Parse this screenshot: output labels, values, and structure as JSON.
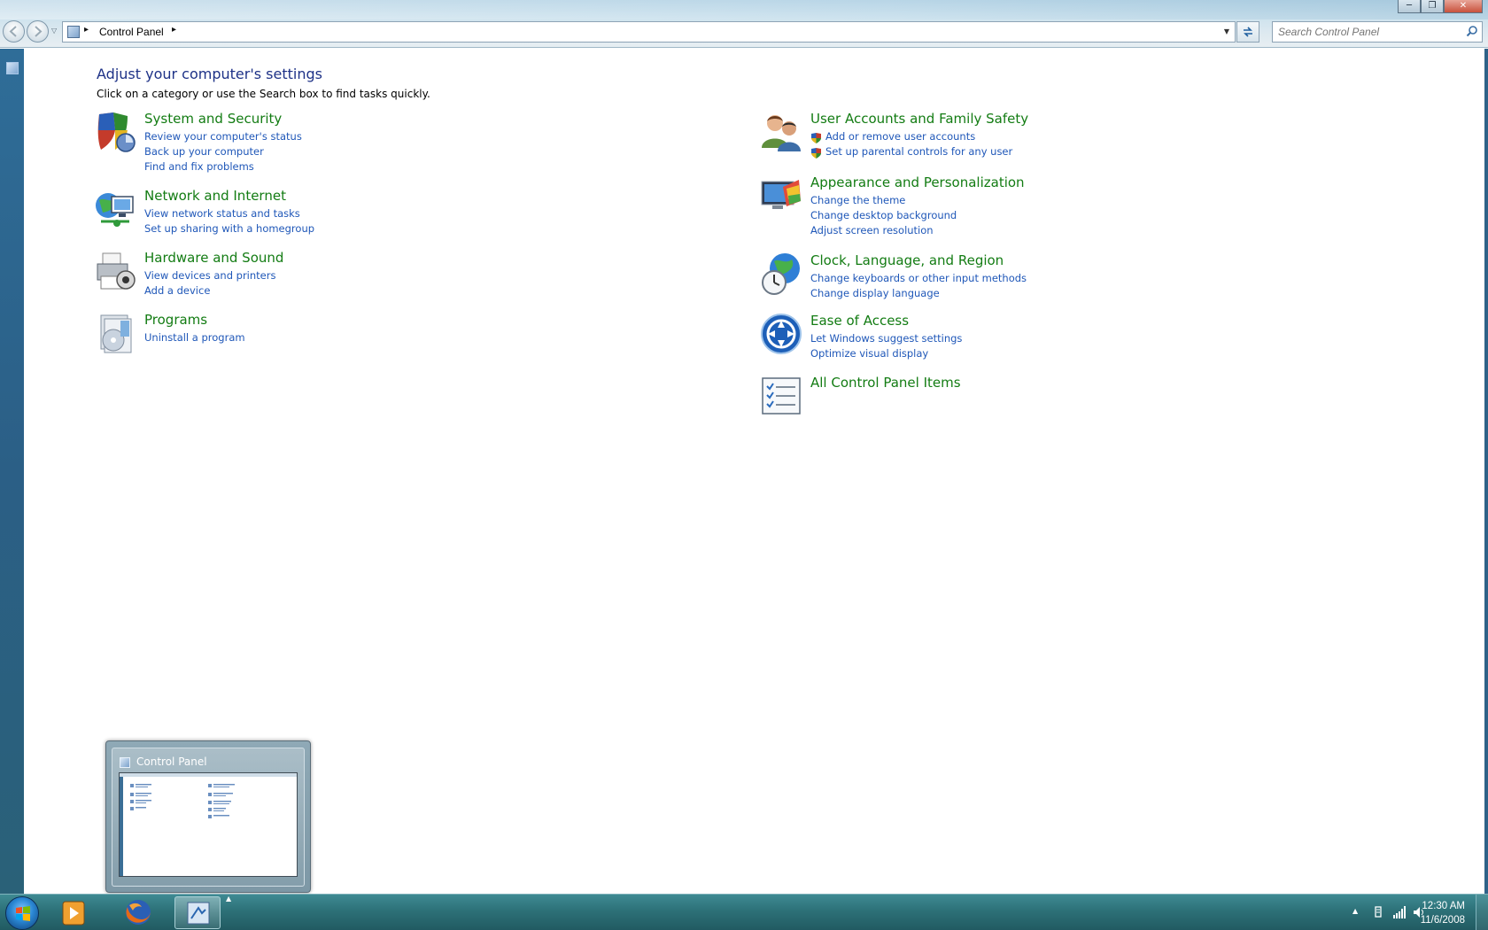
{
  "window": {
    "minimize_label": "─",
    "maximize_label": "❐",
    "close_label": "✕"
  },
  "address": {
    "path_root_arrow": "▸",
    "location": "Control Panel",
    "path_end_arrow": "▸"
  },
  "search": {
    "placeholder": "Search Control Panel"
  },
  "page": {
    "heading": "Adjust your computer's settings",
    "subheading": "Click on a category or use the Search box to find tasks quickly."
  },
  "categories_left": [
    {
      "title": "System and Security",
      "icon": "security-shield-icon",
      "links": [
        "Review your computer's status",
        "Back up your computer",
        "Find and fix problems"
      ]
    },
    {
      "title": "Network and Internet",
      "icon": "network-globe-icon",
      "links": [
        "View network status and tasks",
        "Set up sharing with a homegroup"
      ]
    },
    {
      "title": "Hardware and Sound",
      "icon": "printer-icon",
      "links": [
        "View devices and printers",
        "Add a device"
      ]
    },
    {
      "title": "Programs",
      "icon": "programs-disc-icon",
      "links": [
        "Uninstall a program"
      ]
    }
  ],
  "categories_right": [
    {
      "title": "User Accounts and Family Safety",
      "icon": "users-icon",
      "links": [
        "Add or remove user accounts",
        "Set up parental controls for any user"
      ]
    },
    {
      "title": "Appearance and Personalization",
      "icon": "display-paint-icon",
      "links": [
        "Change the theme",
        "Change desktop background",
        "Adjust screen resolution"
      ]
    },
    {
      "title": "Clock, Language, and Region",
      "icon": "globe-clock-icon",
      "links": [
        "Change keyboards or other input methods",
        "Change display language"
      ]
    },
    {
      "title": "Ease of Access",
      "icon": "ease-of-access-icon",
      "links": [
        "Let Windows suggest settings",
        "Optimize visual display"
      ]
    },
    {
      "title": "All Control Panel Items",
      "icon": "checklist-icon",
      "links": []
    }
  ],
  "preview": {
    "title": "Control Panel"
  },
  "taskbar": {
    "overflow_arrow": "▲",
    "tray_arrow": "▲",
    "time": "12:30 AM",
    "date": "11/6/2008"
  },
  "colors": {
    "heading": "#1e3287",
    "category_title": "#137c13",
    "link": "#1f57b8",
    "taskbar": "#2d7178",
    "left_strip": "#2f6d98"
  }
}
